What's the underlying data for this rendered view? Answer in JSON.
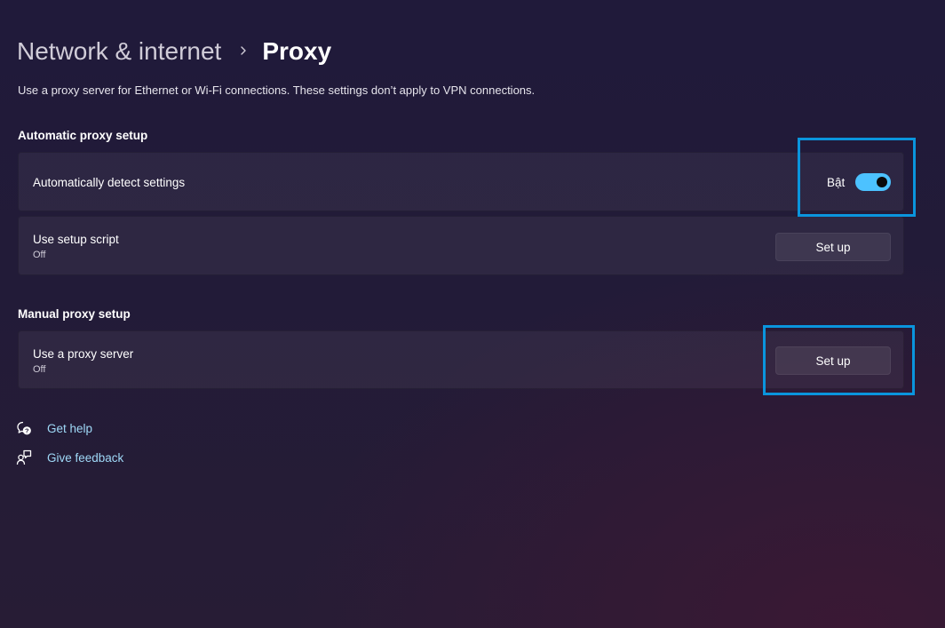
{
  "breadcrumb": {
    "parent": "Network & internet",
    "current": "Proxy"
  },
  "description": "Use a proxy server for Ethernet or Wi-Fi connections. These settings don’t apply to VPN connections.",
  "automatic": {
    "title": "Automatic proxy setup",
    "detect": {
      "label": "Automatically detect settings",
      "state_label": "Bật",
      "enabled": true
    },
    "script": {
      "label": "Use setup script",
      "status": "Off",
      "button": "Set up"
    }
  },
  "manual": {
    "title": "Manual proxy setup",
    "proxy": {
      "label": "Use a proxy server",
      "status": "Off",
      "button": "Set up"
    }
  },
  "links": {
    "help": "Get help",
    "feedback": "Give feedback"
  },
  "icons": {
    "chevron": "chevron-right-icon",
    "help": "help-chat-icon",
    "feedback": "feedback-icon"
  },
  "colors": {
    "accent": "#4cc2ff",
    "highlight": "#0a95dd",
    "link": "#9fd9f7"
  }
}
